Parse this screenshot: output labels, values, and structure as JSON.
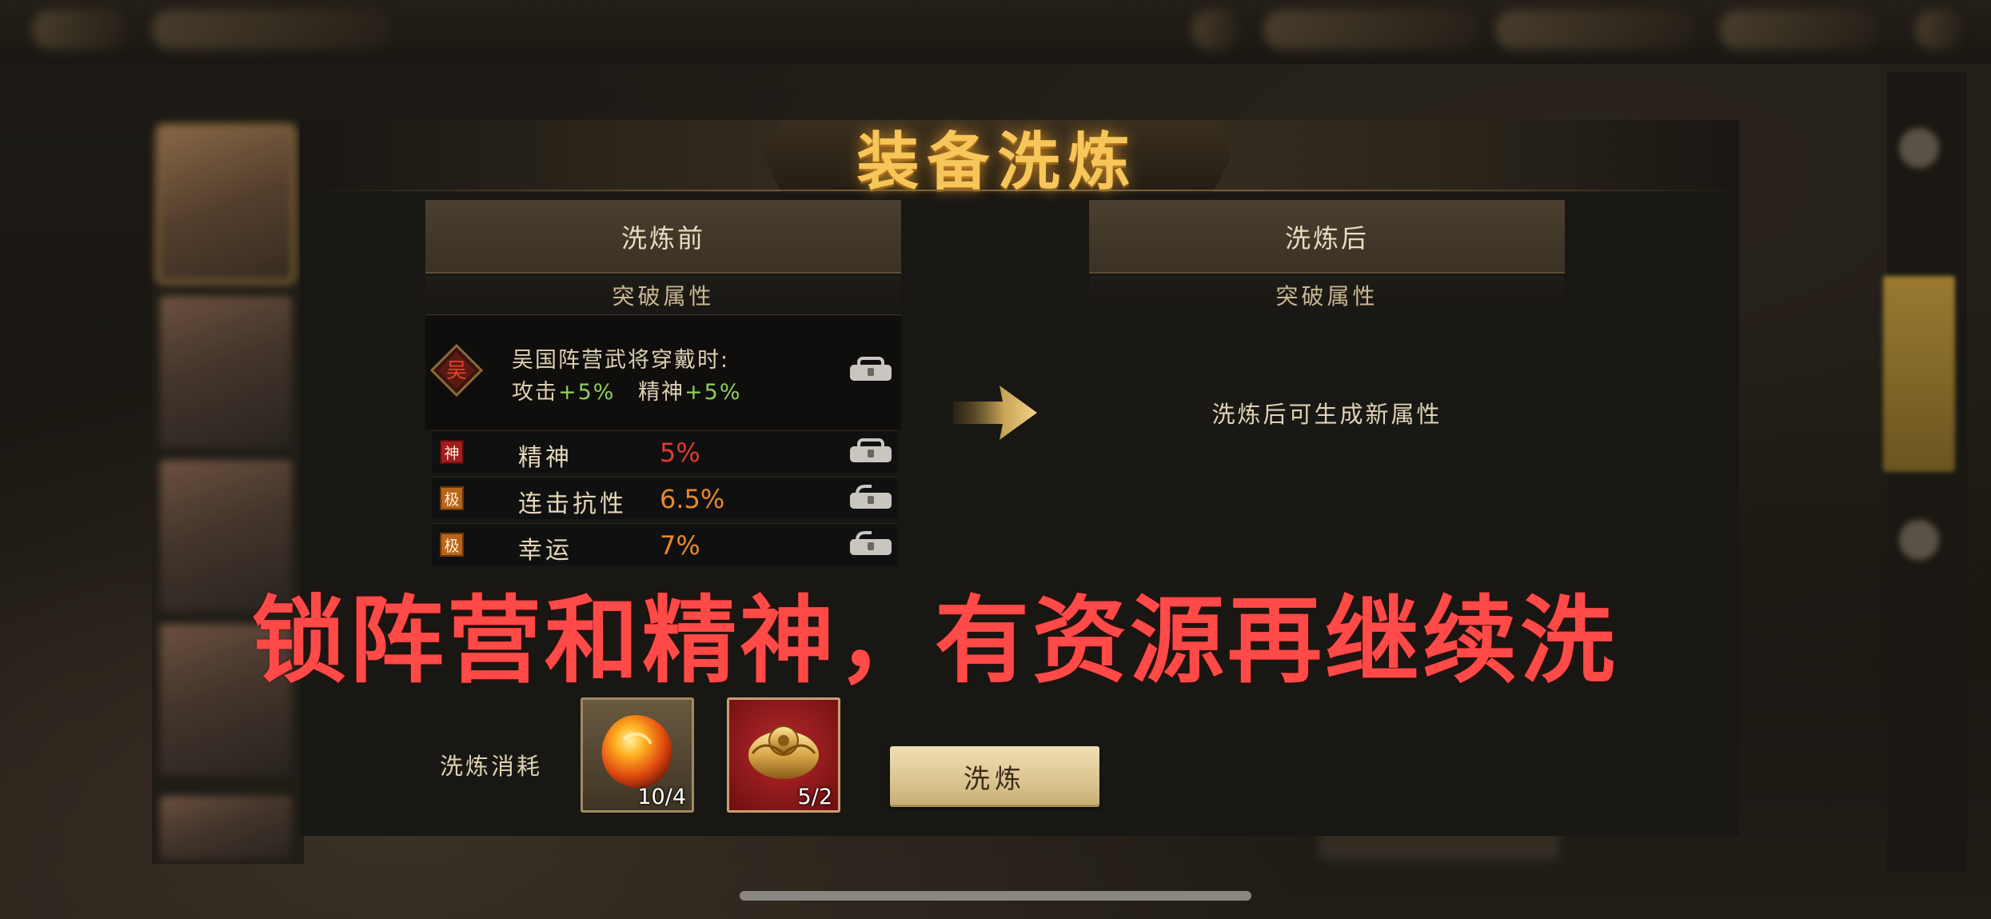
{
  "dialog": {
    "title": "装备洗炼",
    "before_header": "洗炼前",
    "after_header": "洗炼后",
    "breakthrough_label_before": "突破属性",
    "breakthrough_label_after": "突破属性",
    "after_hint": "洗炼后可生成新属性"
  },
  "faction_attr": {
    "badge": "吴",
    "line1": "吴国阵营武将穿戴时:",
    "attack_label": "攻击",
    "attack_value": "+5%",
    "spirit_label": "精神",
    "spirit_value": "+5%",
    "locked": true
  },
  "attributes": [
    {
      "tag": "神",
      "name": "精神",
      "value": "5%",
      "tier_color": "#a21e1e",
      "locked": true
    },
    {
      "tag": "极",
      "name": "连击抗性",
      "value": "6.5%",
      "tier_color": "#b8641a",
      "locked": false
    },
    {
      "tag": "极",
      "name": "幸运",
      "value": "7%",
      "tier_color": "#b8641a",
      "locked": false
    }
  ],
  "overlay_caption": "锁阵营和精神，有资源再继续洗",
  "cost": {
    "label": "洗炼消耗",
    "items": [
      {
        "icon": "fire-stone-icon",
        "count": "10/4"
      },
      {
        "icon": "gold-ornament-icon",
        "count": "5/2"
      }
    ]
  },
  "refine_button": "洗炼",
  "colors": {
    "title_gold": "#f6c65a",
    "bonus_green": "#8ed05a",
    "value_red": "#e03c2c",
    "value_orange": "#e48a2a",
    "overlay_red": "#ff4a48"
  }
}
